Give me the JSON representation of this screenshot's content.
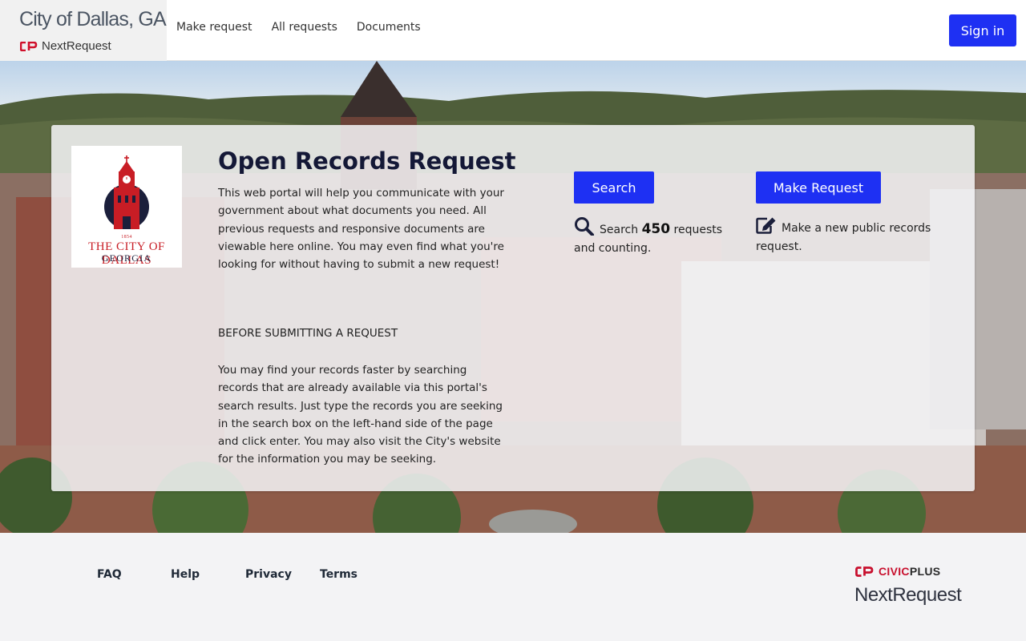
{
  "header": {
    "city_name": "City of Dallas, GA",
    "product_name": "NextRequest",
    "nav": [
      {
        "label": "Make request"
      },
      {
        "label": "All requests"
      },
      {
        "label": "Documents"
      }
    ],
    "signin_label": "Sign in"
  },
  "hero": {
    "logo": {
      "year": "1854",
      "line1": "THE CITY OF DALLAS",
      "line2": "GEORGIA"
    },
    "title": "Open Records Request",
    "intro": "This web portal will help you communicate with your government about what documents you need. All previous requests and responsive documents are viewable here online. You may even find what you're looking for without having to submit a new request!",
    "before_heading": "BEFORE SUBMITTING A REQUEST",
    "before_body": "You may find your records faster by searching records that are already available via this portal's search results. Just type the records you are seeking in the search box on the left-hand side of the page and click enter. You may also visit the City's website for the information you may be seeking.",
    "search": {
      "button_label": "Search",
      "prefix": "Search",
      "count": "450",
      "suffix": "requests and counting.",
      "icon": "search-icon"
    },
    "make": {
      "button_label": "Make Request",
      "text": "Make a new public records request.",
      "icon": "edit-icon"
    }
  },
  "footer": {
    "links": [
      {
        "label": "FAQ"
      },
      {
        "label": "Help"
      },
      {
        "label": "Privacy"
      },
      {
        "label": "Terms"
      }
    ],
    "brand_civic": "CIVIC",
    "brand_plus": "PLUS",
    "brand_product": "NextRequest"
  },
  "colors": {
    "accent": "#1e30f3",
    "brand_red": "#c8102e",
    "heading": "#141836"
  }
}
